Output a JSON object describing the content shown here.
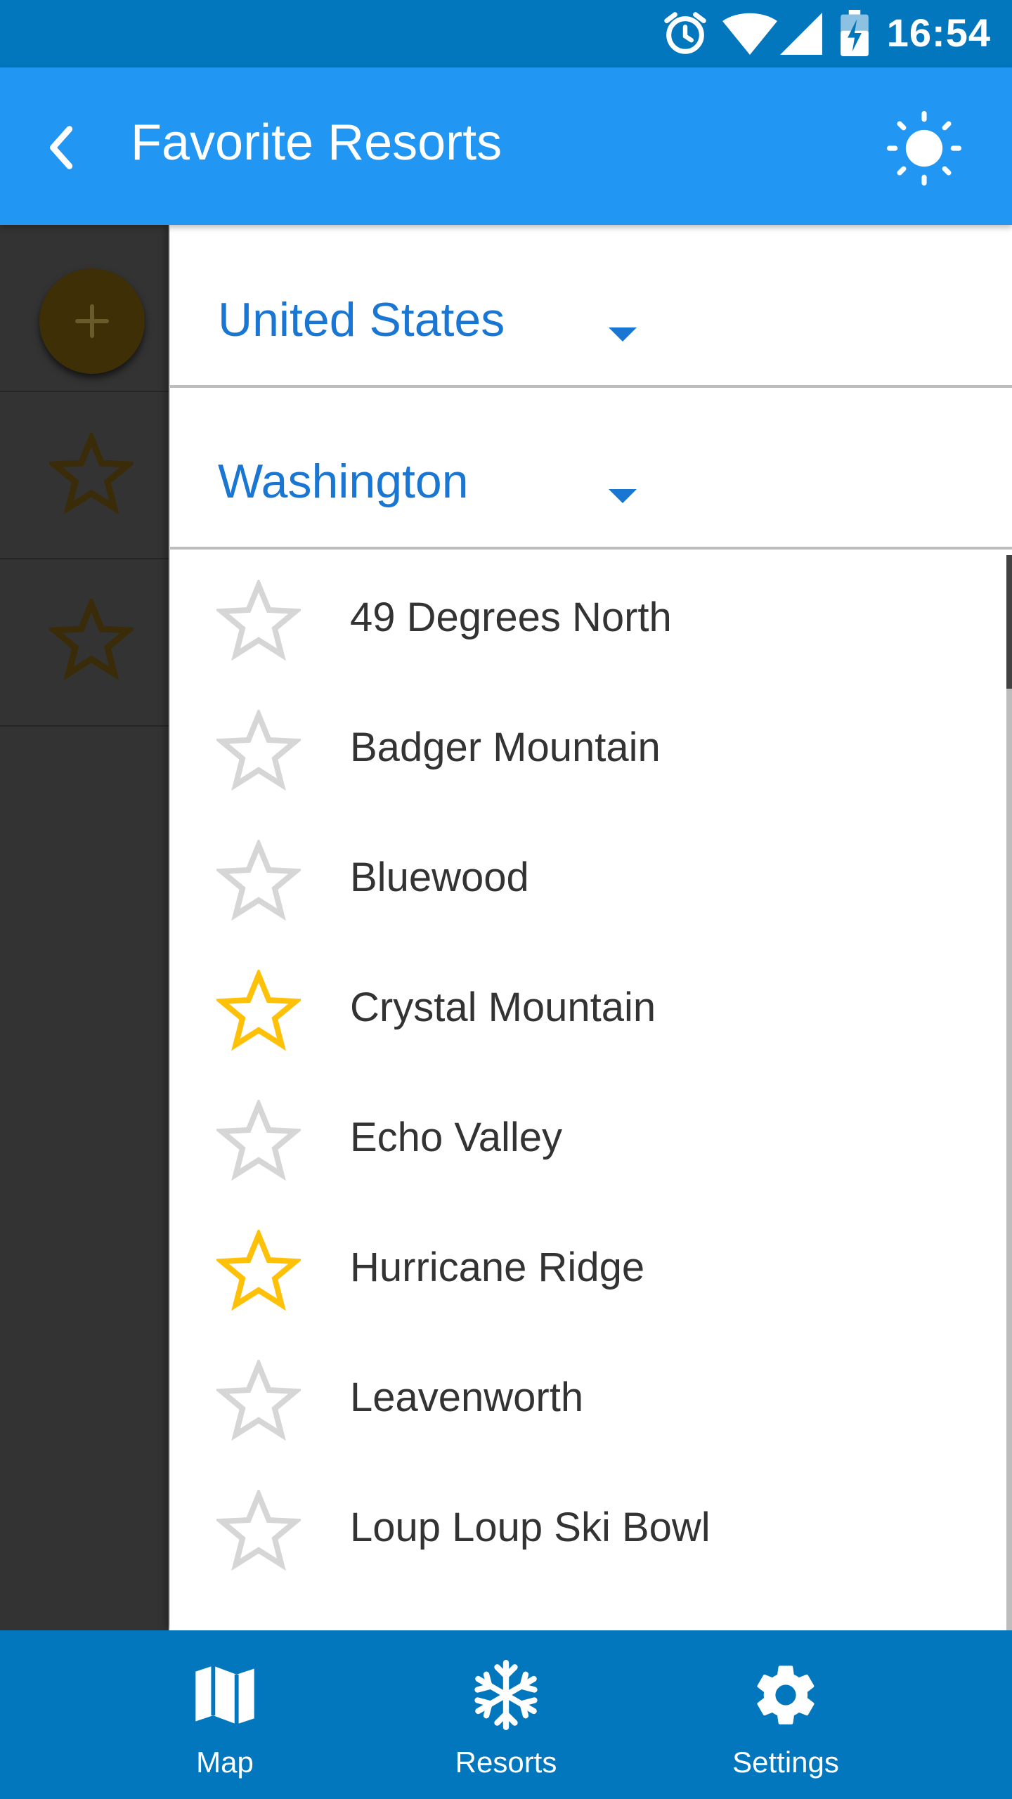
{
  "status_bar": {
    "time": "16:54"
  },
  "app_bar": {
    "title": "Favorite Resorts"
  },
  "filters": {
    "country": "United States",
    "state": "Washington"
  },
  "resorts": [
    {
      "name": "49 Degrees North",
      "favorite": false
    },
    {
      "name": "Badger Mountain",
      "favorite": false
    },
    {
      "name": "Bluewood",
      "favorite": false
    },
    {
      "name": "Crystal Mountain",
      "favorite": true
    },
    {
      "name": "Echo Valley",
      "favorite": false
    },
    {
      "name": "Hurricane Ridge",
      "favorite": true
    },
    {
      "name": "Leavenworth",
      "favorite": false
    },
    {
      "name": "Loup Loup Ski Bowl",
      "favorite": false
    }
  ],
  "bottom_nav": [
    {
      "label": "Map",
      "icon": "map-icon"
    },
    {
      "label": "Resorts",
      "icon": "snowflake-icon"
    },
    {
      "label": "Settings",
      "icon": "gear-icon"
    }
  ],
  "colors": {
    "status_bar": "#0277BD",
    "app_bar": "#2196F3",
    "accent": "#1976D2",
    "favorite_star": "#FFC107",
    "unfavorite_star": "#D6D6D6"
  }
}
